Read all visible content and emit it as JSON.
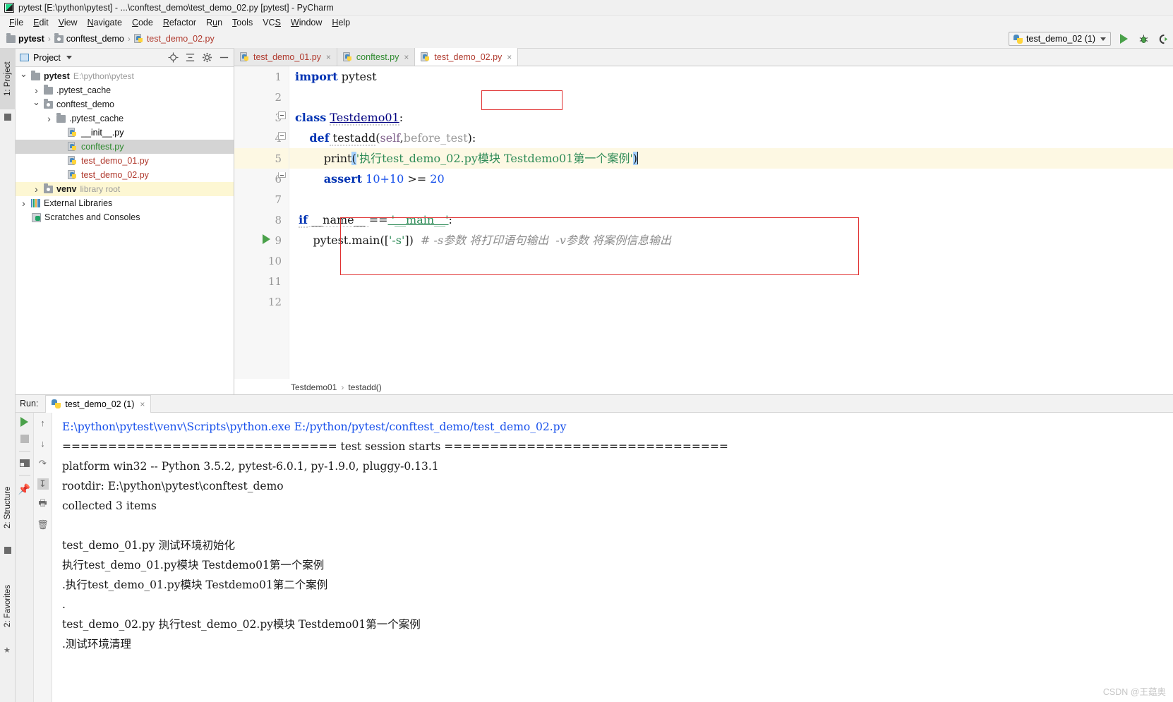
{
  "window": {
    "title": "pytest [E:\\python\\pytest] - ...\\conftest_demo\\test_demo_02.py [pytest] - PyCharm",
    "logo_icon": "pycharm-logo-icon"
  },
  "menubar": {
    "items": [
      "File",
      "Edit",
      "View",
      "Navigate",
      "Code",
      "Refactor",
      "Run",
      "Tools",
      "VCS",
      "Window",
      "Help"
    ]
  },
  "navbar": {
    "breadcrumbs": [
      {
        "label": "pytest",
        "icon": "folder-icon"
      },
      {
        "label": "conftest_demo",
        "icon": "folder-icon"
      },
      {
        "label": "test_demo_02.py",
        "icon": "python-file-icon"
      }
    ],
    "separator": "›",
    "run_config": {
      "label": "test_demo_02 (1)",
      "icon": "python-config-icon"
    },
    "buttons": [
      {
        "name": "run-button",
        "icon": "play-icon"
      },
      {
        "name": "debug-button",
        "icon": "bug-icon"
      },
      {
        "name": "run-with-coverage-button",
        "icon": "coverage-icon"
      }
    ]
  },
  "left_strip": {
    "tabs": [
      {
        "label": "1: Project",
        "icon": "project-icon",
        "active": true
      },
      {
        "label": "2: Structure",
        "icon": "structure-icon",
        "active": false
      },
      {
        "label": "2: Favorites",
        "icon": "star-icon",
        "active": false
      }
    ]
  },
  "project_panel": {
    "title": "Project",
    "header_icons": [
      "locate-icon",
      "collapse-all-icon",
      "gear-icon",
      "minimize-icon"
    ],
    "tree": [
      {
        "label": "pytest",
        "sub": "E:\\python\\pytest",
        "icon": "folder-icon",
        "indent": 0,
        "arrow": "down",
        "bold": true,
        "state": "normal"
      },
      {
        "label": ".pytest_cache",
        "sub": "",
        "icon": "folder-icon",
        "indent": 1,
        "arrow": "right",
        "bold": false,
        "state": "normal"
      },
      {
        "label": "conftest_demo",
        "sub": "",
        "icon": "source-folder-icon",
        "indent": 1,
        "arrow": "down",
        "bold": false,
        "state": "normal"
      },
      {
        "label": ".pytest_cache",
        "sub": "",
        "icon": "folder-icon",
        "indent": 2,
        "arrow": "right",
        "bold": false,
        "state": "normal"
      },
      {
        "label": "__init__.py",
        "sub": "",
        "icon": "python-file-icon",
        "indent": 3,
        "arrow": "none",
        "bold": false,
        "state": "normal"
      },
      {
        "label": "conftest.py",
        "sub": "",
        "icon": "python-file-icon",
        "indent": 3,
        "arrow": "none",
        "bold": false,
        "state": "selected"
      },
      {
        "label": "test_demo_01.py",
        "sub": "",
        "icon": "python-file-icon",
        "indent": 3,
        "arrow": "none",
        "bold": false,
        "state": "normal"
      },
      {
        "label": "test_demo_02.py",
        "sub": "",
        "icon": "python-file-icon",
        "indent": 3,
        "arrow": "none",
        "bold": false,
        "state": "normal"
      },
      {
        "label": "venv",
        "sub": "library root",
        "icon": "source-folder-icon",
        "indent": 1,
        "arrow": "right",
        "bold": false,
        "state": "highlight"
      },
      {
        "label": "External Libraries",
        "sub": "",
        "icon": "libraries-icon",
        "indent": 0,
        "arrow": "right",
        "bold": false,
        "state": "normal"
      },
      {
        "label": "Scratches and Consoles",
        "sub": "",
        "icon": "scratches-icon",
        "indent": 0,
        "arrow": "none",
        "bold": false,
        "state": "normal"
      }
    ]
  },
  "editor": {
    "tabs": [
      {
        "label": "test_demo_01.py",
        "icon": "python-file-icon",
        "active": false,
        "color": "red"
      },
      {
        "label": "conftest.py",
        "icon": "python-file-icon",
        "active": false,
        "color": "green"
      },
      {
        "label": "test_demo_02.py",
        "icon": "python-file-icon",
        "active": true,
        "color": "red"
      }
    ],
    "close_glyph": "×",
    "line_numbers": [
      "1",
      "2",
      "3",
      "4",
      "5",
      "6",
      "7",
      "8",
      "9",
      "10",
      "11",
      "12"
    ],
    "highlighted_line": 5,
    "run_marker_line": 8,
    "code": {
      "l1_kw": "import",
      "l1_mod": "pytest",
      "l3_kw": "class",
      "l3_name": "Testdemo01",
      "l3_colon": ":",
      "l4_kw": "def",
      "l4_name": " testadd",
      "l4_open": "(",
      "l4_p1": "self",
      "l4_comma": ",",
      "l4_p2": "before_test",
      "l4_close": ")",
      "l4_colon": ":",
      "l5_fn": "print",
      "l5_open": "(",
      "l5_str": "'执行test_demo_02.py模块 Testdemo01第一个案例'",
      "l5_close": ")",
      "l6_kw": "assert",
      "l6_expr": " 10+10 ",
      "l6_op": ">=",
      "l6_num": " 20",
      "l8_kw": "if",
      "l8_name": " __name__ ",
      "l8_op": "==",
      "l8_str": " '__main__'",
      "l8_colon": ":",
      "l9_call": "pytest.main([",
      "l9_arg": "'-s'",
      "l9_close": "])",
      "l9_comment": "# -s参数 将打印语句输出  -v参数 将案例信息输出"
    },
    "annotations": [
      {
        "name": "before-test-param-box",
        "color": "#e03131"
      },
      {
        "name": "main-block-box",
        "color": "#e03131"
      }
    ],
    "breadcrumbs": [
      "Testdemo01",
      "testadd()"
    ],
    "breadcrumb_separator": "›"
  },
  "run_window": {
    "label": "Run:",
    "tab": {
      "label": "test_demo_02 (1)",
      "icon": "python-run-icon",
      "close_glyph": "×"
    },
    "toolbar_left": [
      {
        "name": "rerun-button",
        "icon": "play-icon"
      },
      {
        "name": "stop-button",
        "icon": "stop-icon"
      },
      {
        "name": "restore-layout-button",
        "icon": "layout-icon"
      },
      {
        "name": "pin-tab-button",
        "icon": "pin-icon"
      }
    ],
    "toolbar_right": [
      {
        "name": "up-stacktrace-button",
        "icon": "arrow-up-icon"
      },
      {
        "name": "down-stacktrace-button",
        "icon": "arrow-down-icon"
      },
      {
        "name": "soft-wrap-button",
        "icon": "wrap-icon"
      },
      {
        "name": "scroll-to-end-button",
        "icon": "scroll-end-icon",
        "selected": true
      },
      {
        "name": "print-button",
        "icon": "print-icon"
      },
      {
        "name": "clear-all-button",
        "icon": "trash-icon"
      }
    ],
    "console_lines": [
      {
        "text": "E:\\python\\pytest\\venv\\Scripts\\python.exe E:/python/pytest/conftest_demo/test_demo_02.py",
        "style": "link"
      },
      {
        "text": "============================== test session starts ===============================",
        "style": "normal"
      },
      {
        "text": "platform win32 -- Python 3.5.2, pytest-6.0.1, py-1.9.0, pluggy-0.13.1",
        "style": "normal"
      },
      {
        "text": "rootdir: E:\\python\\pytest\\conftest_demo",
        "style": "normal"
      },
      {
        "text": "collected 3 items",
        "style": "normal"
      },
      {
        "text": "",
        "style": "normal"
      },
      {
        "text": "test_demo_01.py 测试环境初始化",
        "style": "normal"
      },
      {
        "text": "执行test_demo_01.py模块 Testdemo01第一个案例",
        "style": "normal"
      },
      {
        "text": ".执行test_demo_01.py模块 Testdemo01第二个案例",
        "style": "normal"
      },
      {
        "text": ".",
        "style": "normal"
      },
      {
        "text": "test_demo_02.py 执行test_demo_02.py模块 Testdemo01第一个案例",
        "style": "normal"
      },
      {
        "text": ".测试环境清理",
        "style": "normal"
      }
    ]
  },
  "watermark": {
    "text": "CSDN @王蕴奥"
  },
  "colors": {
    "accent_green": "#4aa14a",
    "annotation_red": "#e03131",
    "selection_blue": "#a6d2ff",
    "highlight_line": "#fdf8e3",
    "link_blue": "#1750eb"
  }
}
